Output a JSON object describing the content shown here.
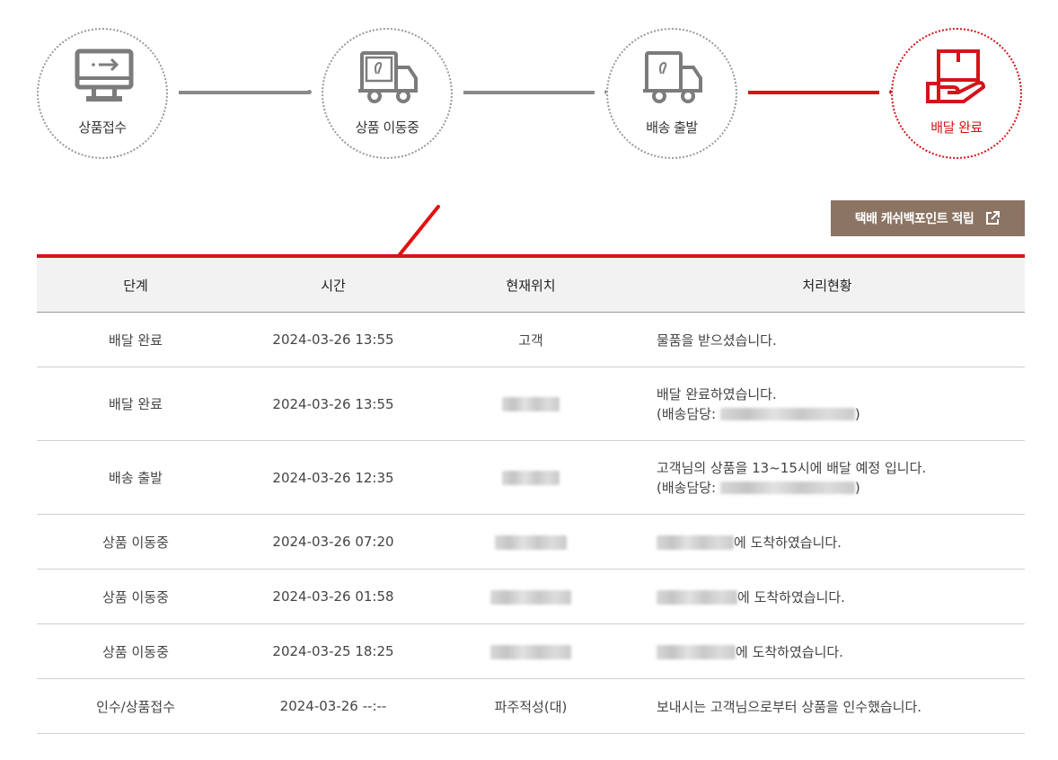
{
  "stepper": {
    "steps": [
      {
        "label": "상품접수",
        "icon": "monitor-icon",
        "active": false
      },
      {
        "label": "상품 이동중",
        "icon": "truck-icon",
        "active": false
      },
      {
        "label": "배송 출발",
        "icon": "truck-icon",
        "active": false
      },
      {
        "label": "배달 완료",
        "icon": "hand-box-icon",
        "active": true
      }
    ]
  },
  "colors": {
    "accent": "#d4141b",
    "button_bg": "#8c7463",
    "inactive": "#8a8a8a"
  },
  "cashback_button": {
    "label": "택배 캐쉬백포인트 적립",
    "icon": "external-link-icon"
  },
  "table": {
    "headers": [
      "단계",
      "시간",
      "현재위치",
      "처리현황"
    ],
    "rows": [
      {
        "stage": "배달 완료",
        "time": "2024-03-26 13:55",
        "location": "고객",
        "status": "물품을 받으셨습니다.",
        "status2": ""
      },
      {
        "stage": "배달 완료",
        "time": "2024-03-26 13:55",
        "location": "",
        "status": "배달 완료하였습니다.",
        "status2": "(배송담당: )"
      },
      {
        "stage": "배송 출발",
        "time": "2024-03-26 12:35",
        "location": "",
        "status": "고객님의 상품을 13~15시에 배달 예정 입니다.",
        "status2": "(배송담당: )"
      },
      {
        "stage": "상품 이동중",
        "time": "2024-03-26 07:20",
        "location": "",
        "status": "에 도착하였습니다.",
        "status2": ""
      },
      {
        "stage": "상품 이동중",
        "time": "2024-03-26 01:58",
        "location": "",
        "status": "에 도착하였습니다.",
        "status2": ""
      },
      {
        "stage": "상품 이동중",
        "time": "2024-03-25 18:25",
        "location": "",
        "status": "에 도착하였습니다.",
        "status2": ""
      },
      {
        "stage": "인수/상품접수",
        "time": "2024-03-26 --:--",
        "location": "파주적성(대)",
        "status": "보내시는 고객님으로부터 상품을 인수했습니다.",
        "status2": ""
      }
    ]
  }
}
